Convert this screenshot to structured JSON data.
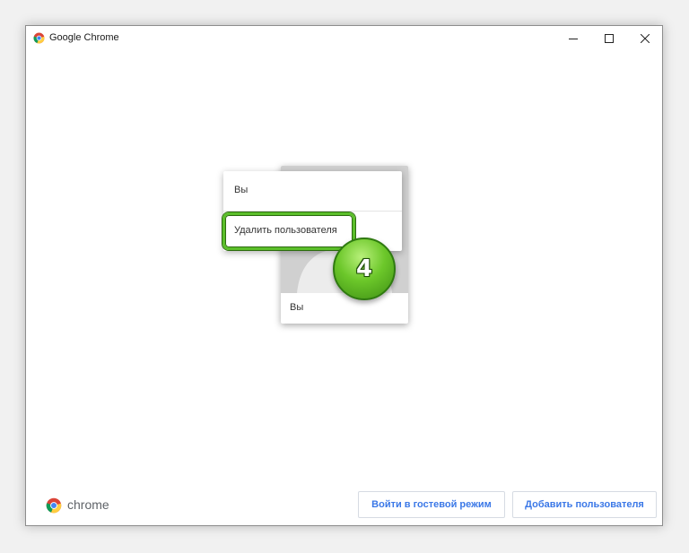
{
  "window": {
    "title": "Google Chrome",
    "controls": {
      "minimize": "minimize",
      "maximize": "maximize",
      "close": "close"
    }
  },
  "profile_card": {
    "name": "Вы"
  },
  "context_menu": {
    "items": [
      {
        "label": "Вы"
      },
      {
        "label": "Удалить пользователя"
      }
    ]
  },
  "annotation": {
    "step_number": "4",
    "highlight_color": "#5bbf2a"
  },
  "footer": {
    "brand": "chrome",
    "guest_button": "Войти в гостевой режим",
    "add_user_button": "Добавить пользователя"
  },
  "colors": {
    "accent": "#3b78e7",
    "background": "#ffffff"
  }
}
